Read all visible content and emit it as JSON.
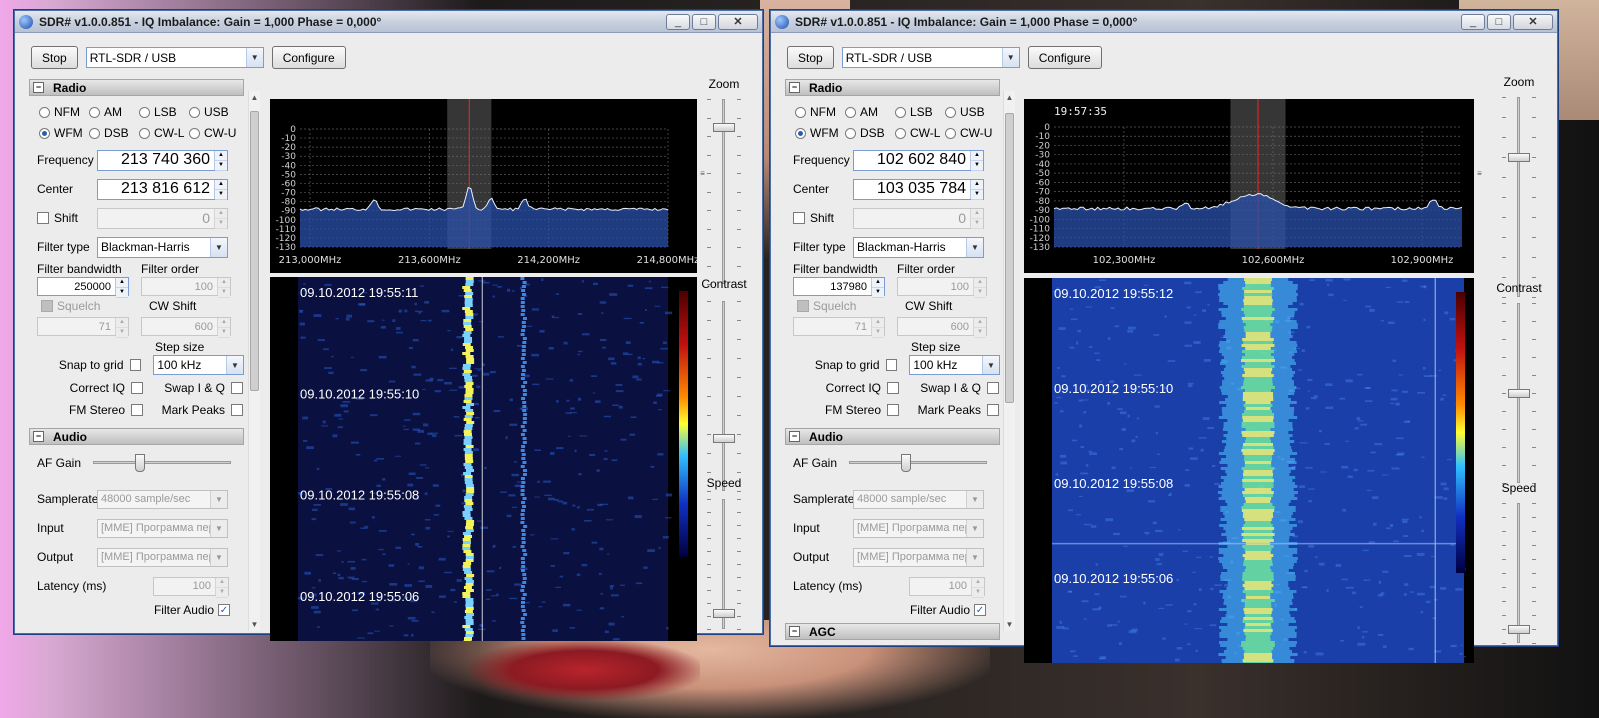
{
  "windows": [
    {
      "title": "SDR# v1.0.0.851 - IQ Imbalance: Gain = 1,000 Phase = 0,000°",
      "title_buttons": {
        "minimize": "_",
        "maximize": "□",
        "close": "✕"
      },
      "stop_label": "Stop",
      "device": "RTL-SDR / USB",
      "configure_label": "Configure",
      "radio_header": "Radio",
      "modes_row1": [
        "NFM",
        "AM",
        "LSB",
        "USB"
      ],
      "modes_row2": [
        "WFM",
        "DSB",
        "CW-L",
        "CW-U"
      ],
      "selected_mode": "WFM",
      "frequency_label": "Frequency",
      "frequency": "213 740 360",
      "center_label": "Center",
      "center": "213 816 612",
      "shift_label": "Shift",
      "shift_value": "0",
      "filter_type_label": "Filter type",
      "filter_type": "Blackman-Harris",
      "filter_bandwidth_label": "Filter bandwidth",
      "filter_bandwidth": "250000",
      "filter_order_label": "Filter order",
      "filter_order": "100",
      "squelch_label": "Squelch",
      "squelch": "71",
      "cw_shift_label": "CW Shift",
      "cw_shift": "600",
      "step_size_label": "Step size",
      "snap_label": "Snap to grid",
      "step_size": "100 kHz",
      "correct_iq_label": "Correct IQ",
      "swap_iq_label": "Swap I & Q",
      "fm_stereo_label": "FM Stereo",
      "mark_peaks_label": "Mark Peaks",
      "audio_header": "Audio",
      "af_gain_label": "AF Gain",
      "af_gain": 0.33,
      "samplerate_label": "Samplerate",
      "samplerate": "48000 sample/sec",
      "input_label": "Input",
      "input": "[MME] Программа пер",
      "output_label": "Output",
      "output": "[MME] Программа пер",
      "latency_label": "Latency (ms)",
      "latency": "100",
      "filter_audio_label": "Filter Audio",
      "agc_header": "",
      "zoom_label": "Zoom",
      "contrast_label": "Contrast",
      "speed_label": "Speed",
      "zoom": 0.15,
      "contrast": 0.72,
      "speed": 0.88,
      "spectrum": {
        "time": "",
        "db_ticks": [
          "0",
          "-10",
          "-20",
          "-30",
          "-40",
          "-50",
          "-60",
          "-70",
          "-80",
          "-90",
          "-100",
          "-110",
          "-120",
          "-130"
        ],
        "freq_ticks": [
          "213,000MHz",
          "213,600MHz",
          "214,200MHz",
          "214,800MHz"
        ],
        "peaks": [
          0.2,
          0.46,
          0.52,
          0.61
        ]
      },
      "waterfall": {
        "timestamps": [
          "09.10.2012 19:55:11",
          "09.10.2012 19:55:10",
          "09.10.2012 19:55:08",
          "09.10.2012 19:55:06"
        ]
      },
      "colors": {
        "band": "#3aa4ff"
      }
    },
    {
      "title": "SDR# v1.0.0.851 - IQ Imbalance: Gain = 1,000 Phase = 0,000°",
      "title_buttons": {
        "minimize": "_",
        "maximize": "□",
        "close": "✕"
      },
      "stop_label": "Stop",
      "device": "RTL-SDR / USB",
      "configure_label": "Configure",
      "radio_header": "Radio",
      "modes_row1": [
        "NFM",
        "AM",
        "LSB",
        "USB"
      ],
      "modes_row2": [
        "WFM",
        "DSB",
        "CW-L",
        "CW-U"
      ],
      "selected_mode": "WFM",
      "frequency_label": "Frequency",
      "frequency": "102 602 840",
      "center_label": "Center",
      "center": "103 035 784",
      "shift_label": "Shift",
      "shift_value": "0",
      "filter_type_label": "Filter type",
      "filter_type": "Blackman-Harris",
      "filter_bandwidth_label": "Filter bandwidth",
      "filter_bandwidth": "137980",
      "filter_order_label": "Filter order",
      "filter_order": "100",
      "squelch_label": "Squelch",
      "squelch": "71",
      "cw_shift_label": "CW Shift",
      "cw_shift": "600",
      "step_size_label": "Step size",
      "snap_label": "Snap to grid",
      "step_size": "100 kHz",
      "correct_iq_label": "Correct IQ",
      "swap_iq_label": "Swap I & Q",
      "fm_stereo_label": "FM Stereo",
      "mark_peaks_label": "Mark Peaks",
      "audio_header": "Audio",
      "af_gain_label": "AF Gain",
      "af_gain": 0.41,
      "samplerate_label": "Samplerate",
      "samplerate": "48000 sample/sec",
      "input_label": "Input",
      "input": "[MME] Программа пер",
      "output_label": "Output",
      "output": "[MME] Программа пер",
      "latency_label": "Latency (ms)",
      "latency": "100",
      "filter_audio_label": "Filter Audio",
      "agc_header": "AGC",
      "zoom_label": "Zoom",
      "contrast_label": "Contrast",
      "speed_label": "Speed",
      "zoom": 0.3,
      "contrast": 0.5,
      "speed": 0.9,
      "spectrum": {
        "time": "19:57:35",
        "db_ticks": [
          "0",
          "-10",
          "-20",
          "-30",
          "-40",
          "-50",
          "-60",
          "-70",
          "-80",
          "-90",
          "-100",
          "-110",
          "-120",
          "-130"
        ],
        "freq_ticks": [
          "102,300MHz",
          "102,600MHz",
          "102,900MHz"
        ],
        "peaks": [
          0.32,
          0.49,
          0.93
        ]
      },
      "waterfall": {
        "timestamps": [
          "09.10.2012 19:55:12",
          "09.10.2012 19:55:10",
          "09.10.2012 19:55:08",
          "09.10.2012 19:55:06"
        ]
      },
      "colors": {
        "band": "#ffd23a"
      }
    }
  ]
}
